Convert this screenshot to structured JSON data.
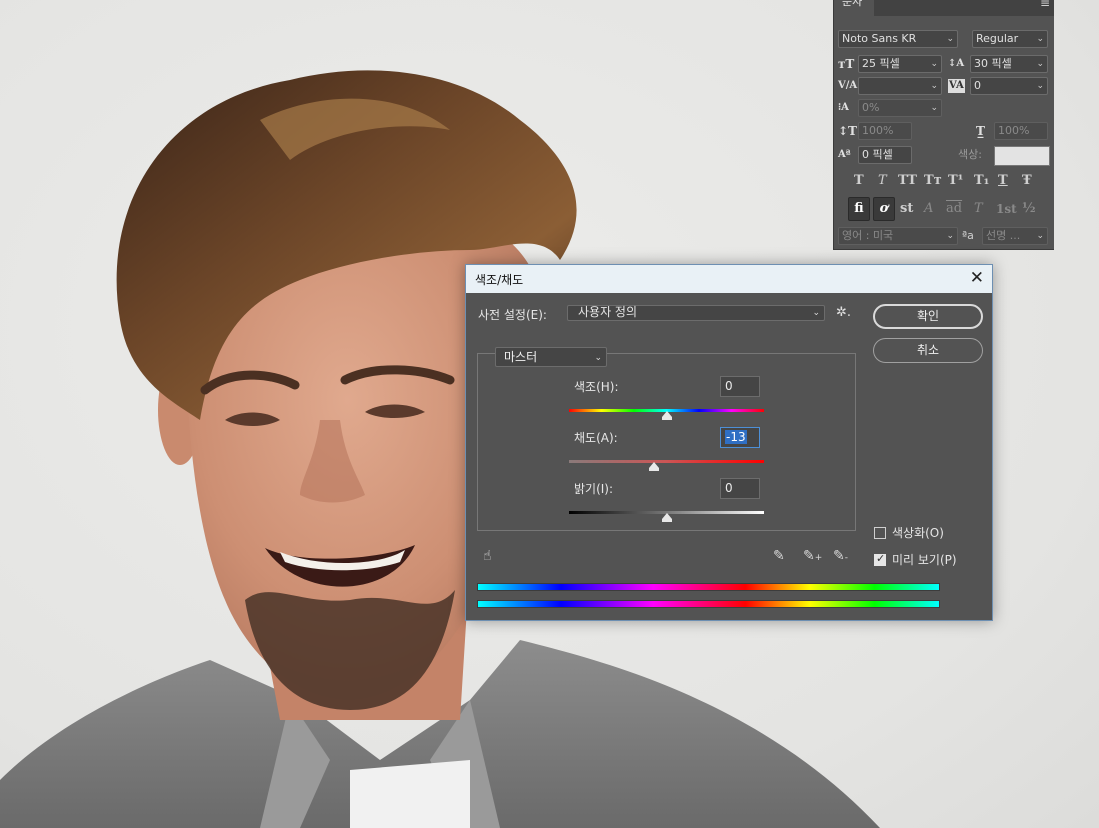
{
  "character_panel": {
    "tab": "문자",
    "font_family": "Noto Sans KR",
    "font_style": "Regular",
    "font_size": "25 픽셀",
    "leading": "30 픽셀",
    "kerning": "",
    "tracking": "0",
    "tsume": "0%",
    "vertical_scale": "100%",
    "horizontal_scale": "100%",
    "baseline_shift": "0 픽셀",
    "color_label": "색상:",
    "color_value": "#e3e3e3",
    "style_buttons": [
      "T",
      "T",
      "TT",
      "Tт",
      "T¹",
      "T₁",
      "T",
      "Ŧ"
    ],
    "opentype_buttons": [
      "fi",
      "ơ",
      "st",
      "A",
      "ad",
      "T",
      "1st",
      "½"
    ],
    "language": "영어 : 미국",
    "aa_label": "ªa",
    "antialias": "선명 ..."
  },
  "dialog": {
    "title": "색조/채도",
    "preset_label": "사전 설정(E):",
    "preset_value": "사용자 정의",
    "ok_label": "확인",
    "cancel_label": "취소",
    "channel": "마스터",
    "sliders": [
      {
        "label": "색조(H):",
        "value": "0",
        "position": 0.5
      },
      {
        "label": "채도(A):",
        "value": "-13",
        "position": 0.435
      },
      {
        "label": "밝기(I):",
        "value": "0",
        "position": 0.5
      }
    ],
    "colorize_label": "색상화(O)",
    "colorize_checked": false,
    "preview_label": "미리 보기(P)",
    "preview_checked": true
  }
}
